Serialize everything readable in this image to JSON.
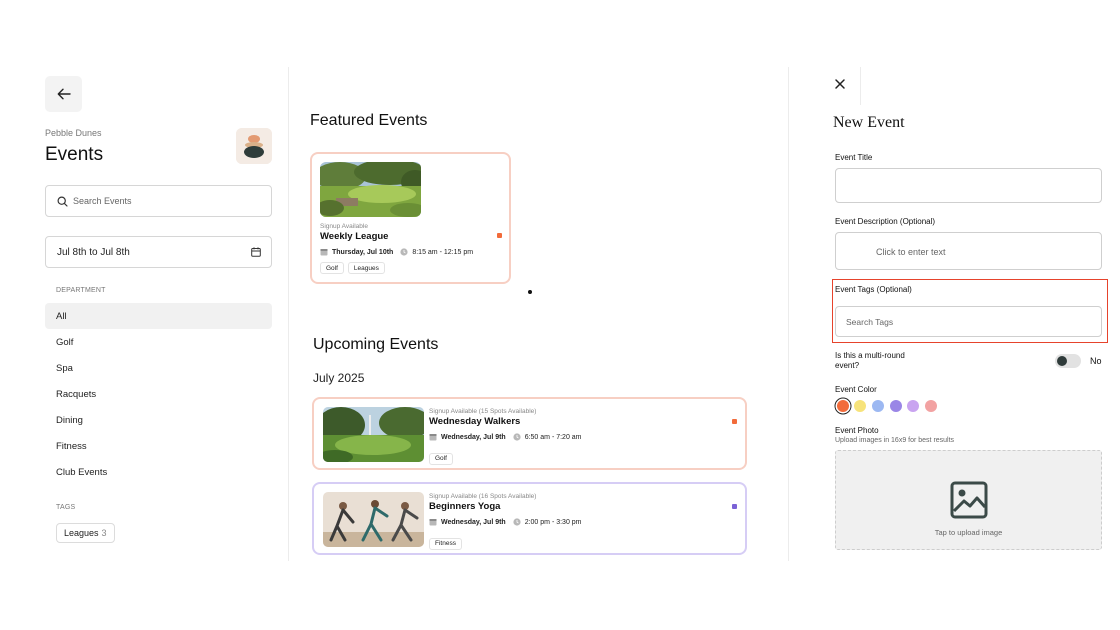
{
  "sidebar": {
    "club_name": "Pebble Dunes",
    "title": "Events",
    "search_placeholder": "Search Events",
    "date_range": "Jul 8th to Jul 8th",
    "department_heading": "DEPARTMENT",
    "departments": [
      "All",
      "Golf",
      "Spa",
      "Racquets",
      "Dining",
      "Fitness",
      "Club Events"
    ],
    "active_department": "All",
    "tags_heading": "TAGS",
    "tags": [
      {
        "label": "Leagues",
        "count": "3"
      }
    ]
  },
  "featured": {
    "heading": "Featured Events",
    "card": {
      "status": "Signup Available",
      "name": "Weekly League",
      "date": "Thursday, Jul 10th",
      "time": "8:15 am - 12:15 pm",
      "tags": [
        "Golf",
        "Leagues"
      ],
      "color": "#f26b3a",
      "border_color": "#f7cfc3"
    }
  },
  "upcoming": {
    "heading": "Upcoming Events",
    "month": "July 2025",
    "cards": [
      {
        "status": "Signup Available (15 Spots Available)",
        "name": "Wednesday Walkers",
        "date": "Wednesday, Jul 9th",
        "time": "6:50 am - 7:20 am",
        "tag": "Golf",
        "color": "#f26b3a",
        "border_color": "#f7cfc3"
      },
      {
        "status": "Signup Available (16 Spots Available)",
        "name": "Beginners Yoga",
        "date": "Wednesday, Jul 9th",
        "time": "2:00 pm - 3:30 pm",
        "tag": "Fitness",
        "color": "#7b62d6",
        "border_color": "#d6cdf5"
      }
    ]
  },
  "form": {
    "title": "New Event",
    "event_title_label": "Event Title",
    "event_title_value": "",
    "description_label": "Event Description (Optional)",
    "description_placeholder": "Click to enter text",
    "tags_label": "Event Tags (Optional)",
    "tags_placeholder": "Search Tags",
    "multi_round_label": "Is this a multi-round event?",
    "multi_round_value": "No",
    "color_label": "Event Color",
    "colors": [
      "#f26b3a",
      "#f7e37a",
      "#9cb8f2",
      "#9a86e6",
      "#c9a4f0",
      "#f2a2a2"
    ],
    "selected_color": "#f26b3a",
    "photo_label": "Event Photo",
    "photo_hint": "Upload images in 16x9 for best results",
    "upload_hint": "Tap to upload image"
  },
  "icons": {
    "back": "arrow-left-icon",
    "search": "search-icon",
    "calendar": "calendar-icon",
    "clock": "clock-icon",
    "close": "close-icon",
    "image": "image-icon"
  }
}
